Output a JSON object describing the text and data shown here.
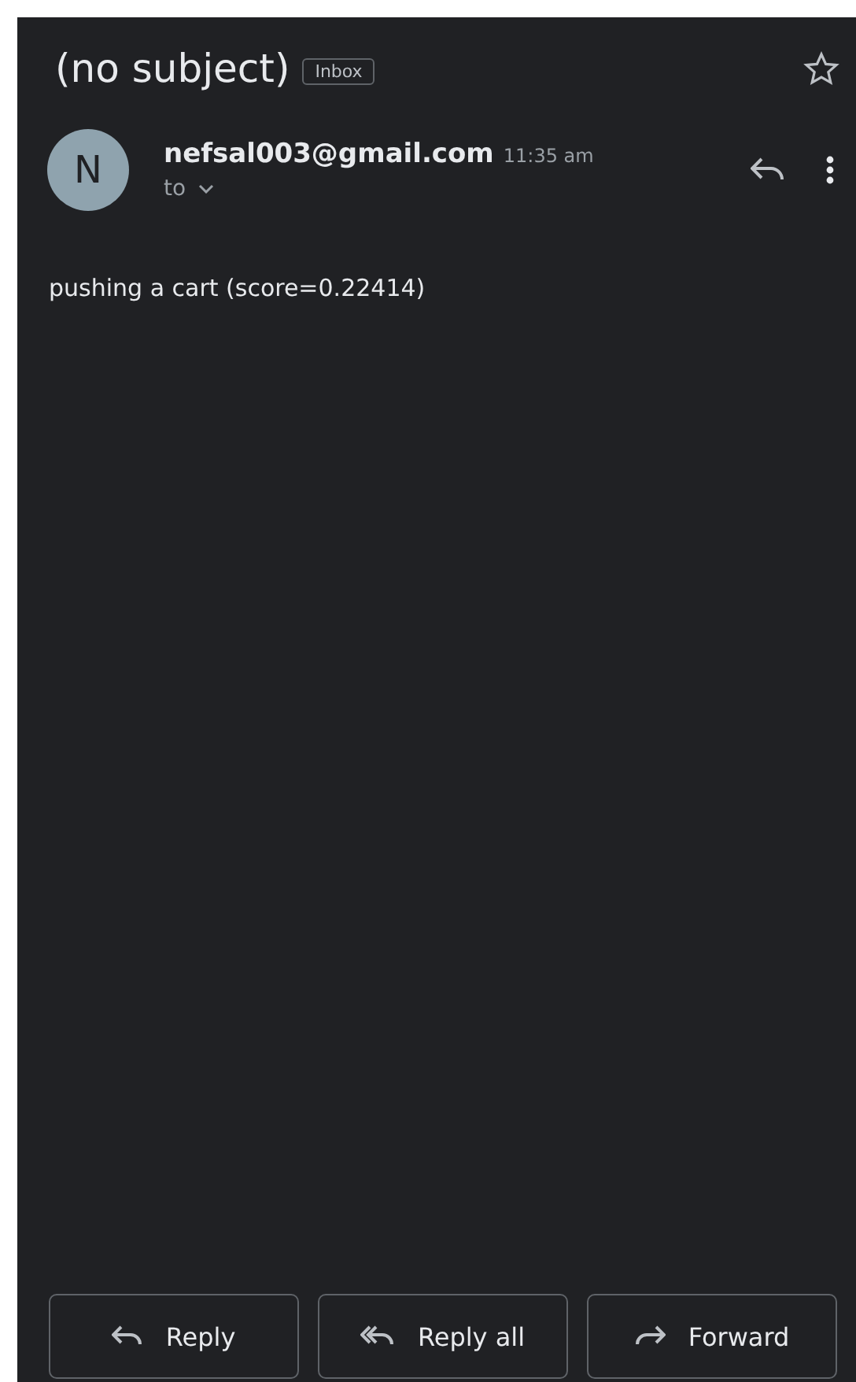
{
  "subject": "(no subject)",
  "label": "Inbox",
  "starred": false,
  "message": {
    "avatar": "N",
    "sender": "nefsal003@gmail.com",
    "time": "11:35 am",
    "recipient": "to",
    "body": "pushing a cart (score=0.22414)"
  },
  "actions": [
    {
      "kind": "reply",
      "label": "Reply"
    },
    {
      "kind": "reply_all",
      "label": "Reply all"
    },
    {
      "kind": "forward",
      "label": "Forward"
    }
  ]
}
